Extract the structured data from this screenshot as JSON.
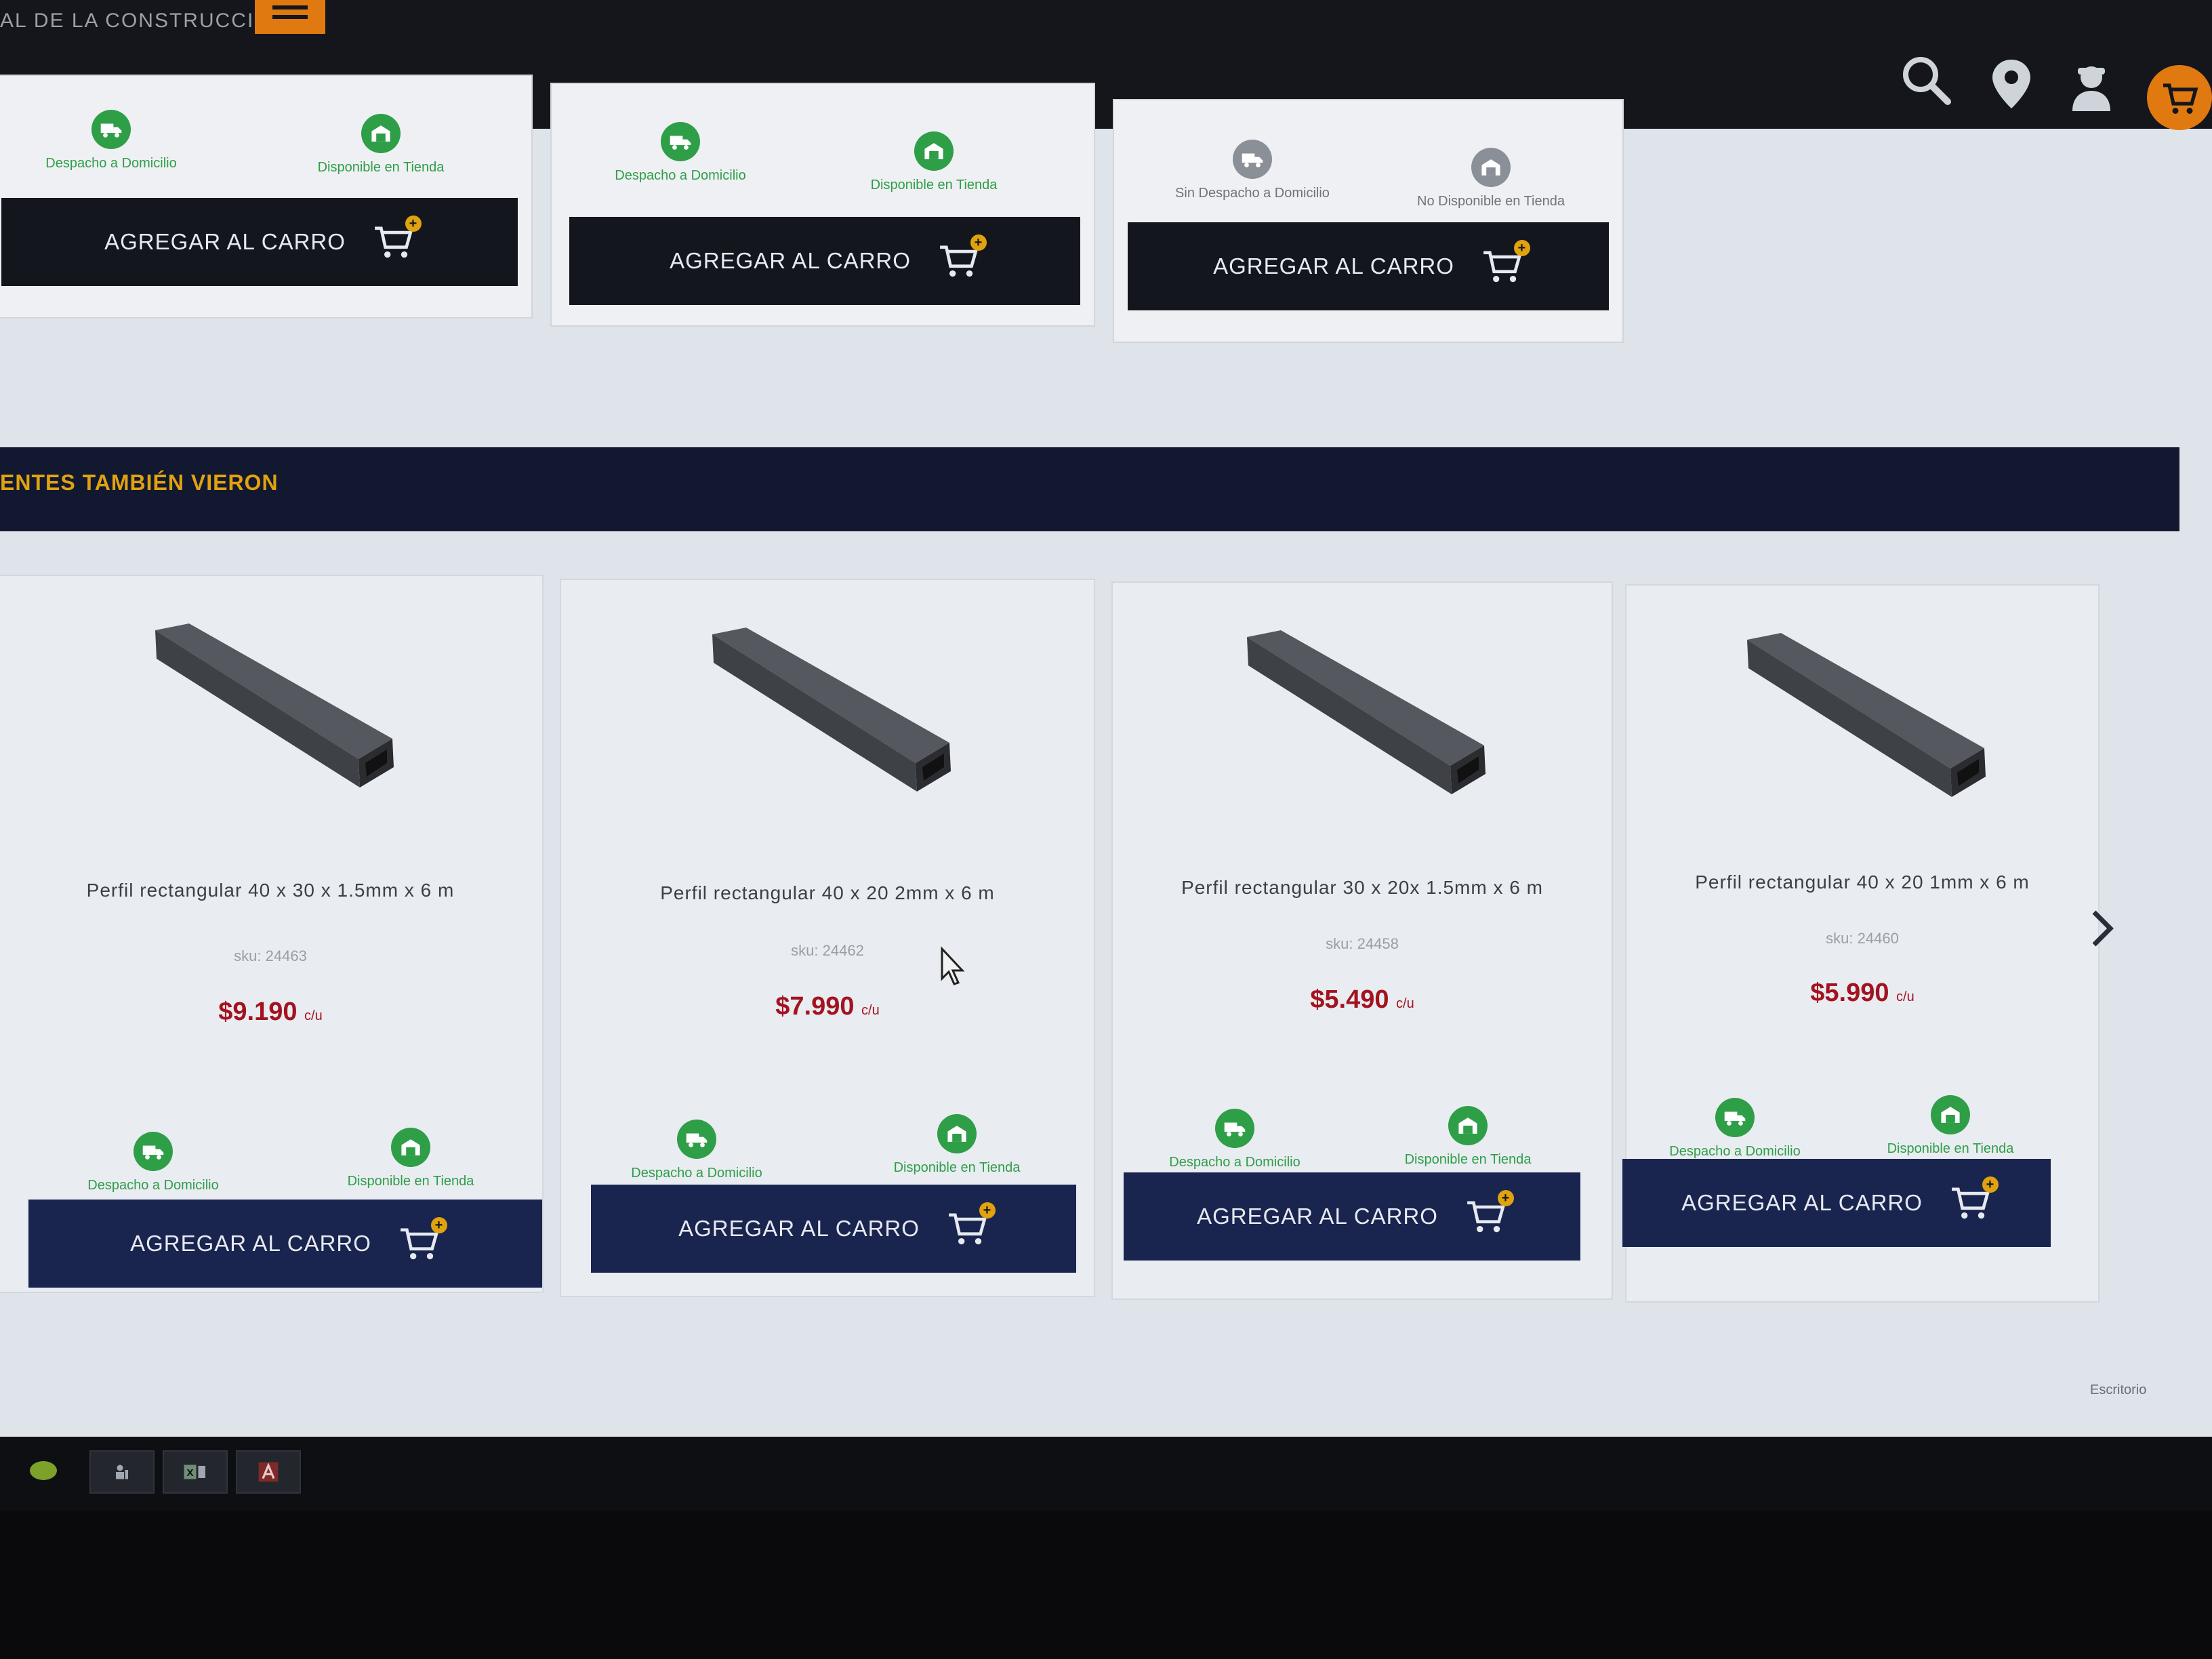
{
  "header": {
    "logo_subtitle": "AL DE LA CONSTRUCCION",
    "icons": [
      "search-icon",
      "location-pin-icon",
      "user-icon",
      "cart-icon"
    ]
  },
  "top_cards": [
    {
      "delivery": "Despacho a Domicilio",
      "store": "Disponible en Tienda",
      "delivery_ok": true,
      "store_ok": true,
      "button": "AGREGAR AL CARRO"
    },
    {
      "delivery": "Despacho a Domicilio",
      "store": "Disponible en Tienda",
      "delivery_ok": true,
      "store_ok": true,
      "button": "AGREGAR AL CARRO"
    },
    {
      "delivery": "Sin Despacho a Domicilio",
      "store": "No Disponible en Tienda",
      "delivery_ok": false,
      "store_ok": false,
      "button": "AGREGAR AL CARRO"
    }
  ],
  "section": {
    "title": "ENTES TAMBIÉN VIERON"
  },
  "products": [
    {
      "name": "Perfil rectangular 40 x 30 x 1.5mm x 6 m",
      "sku": "sku: 24463",
      "price": "$9.190",
      "unit": "c/u",
      "delivery": "Despacho a Domicilio",
      "store": "Disponible en Tienda",
      "button": "AGREGAR AL CARRO"
    },
    {
      "name": "Perfil rectangular 40 x 20 2mm x 6 m",
      "sku": "sku: 24462",
      "price": "$7.990",
      "unit": "c/u",
      "delivery": "Despacho a Domicilio",
      "store": "Disponible en Tienda",
      "button": "AGREGAR AL CARRO"
    },
    {
      "name": "Perfil rectangular 30 x 20x 1.5mm x 6 m",
      "sku": "sku: 24458",
      "price": "$5.490",
      "unit": "c/u",
      "delivery": "Despacho a Domicilio",
      "store": "Disponible en Tienda",
      "button": "AGREGAR AL CARRO"
    },
    {
      "name": "Perfil rectangular 40 x 20 1mm x 6 m",
      "sku": "sku: 24460",
      "price": "$5.990",
      "unit": "c/u",
      "delivery": "Despacho a Domicilio",
      "store": "Disponible en Tienda",
      "button": "AGREGAR AL CARRO"
    }
  ],
  "desktop": {
    "label": "Escritorio"
  },
  "taskbar": {
    "items": [
      "start-icon",
      "people-app-icon",
      "excel-icon",
      "acrobat-icon"
    ]
  },
  "colors": {
    "header": "#14161c",
    "accent": "#e07a10",
    "navy": "#19244f",
    "price": "#a3131f",
    "available": "#2e9e47",
    "unavailable": "#8b8f97"
  }
}
